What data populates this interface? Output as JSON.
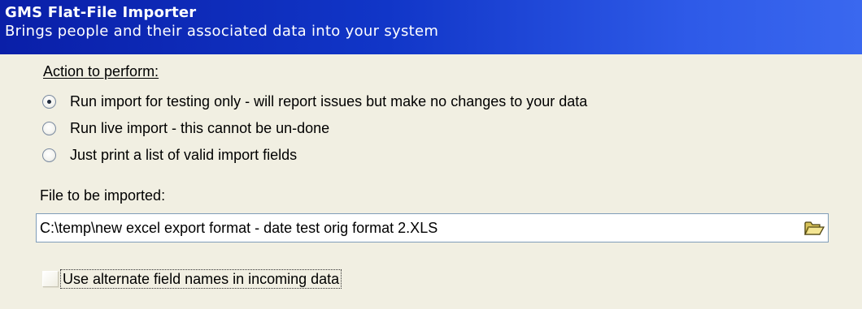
{
  "header": {
    "title": "GMS Flat-File Importer",
    "subtitle": "Brings people and their associated data into your system"
  },
  "action": {
    "label": "Action to perform:",
    "options": [
      {
        "label": "Run import for testing only - will report issues but make no changes to your data",
        "selected": true
      },
      {
        "label": "Run live import - this cannot be un-done",
        "selected": false
      },
      {
        "label": "Just print a list of valid import fields",
        "selected": false
      }
    ]
  },
  "file": {
    "label": "File to be imported:",
    "value": "C:\\temp\\new excel export format - date test orig format 2.XLS",
    "browse_icon": "open-folder-icon"
  },
  "alternate_names": {
    "label": "Use alternate field names in incoming data",
    "checked": false
  },
  "colors": {
    "header_start": "#0a1fa8",
    "header_end": "#3a68ef",
    "background": "#f1efe2",
    "input_border": "#7f9db9"
  }
}
